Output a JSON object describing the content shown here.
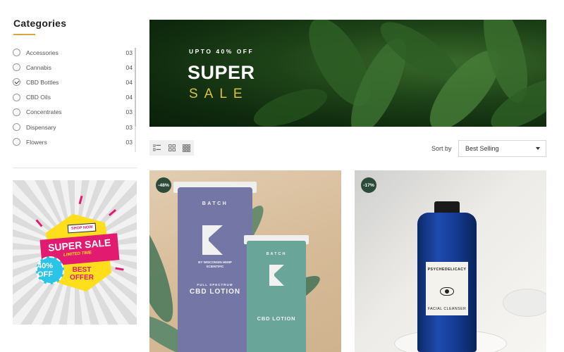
{
  "sidebar": {
    "title": "Categories",
    "categories": [
      {
        "label": "Accessories",
        "count": "03",
        "checked": false
      },
      {
        "label": "Cannabis",
        "count": "04",
        "checked": false
      },
      {
        "label": "CBD Bottles",
        "count": "04",
        "checked": true
      },
      {
        "label": "CBD Oils",
        "count": "04",
        "checked": false
      },
      {
        "label": "Concentrates",
        "count": "03",
        "checked": false
      },
      {
        "label": "Dispensary",
        "count": "03",
        "checked": false
      },
      {
        "label": "Flowers",
        "count": "03",
        "checked": false
      }
    ],
    "promo": {
      "shop_now": "SHOP NOW",
      "super_sale": "SUPER SALE",
      "limited_time": "LIMITED TIME",
      "badge": "40% OFF",
      "best_offer": "BEST OFFER"
    }
  },
  "banner": {
    "upto": "UPTO 40% OFF",
    "headline": "SUPER",
    "subheadline": "SALE"
  },
  "toolbar": {
    "views": [
      "list-view-icon",
      "grid-2-icon",
      "grid-3-icon"
    ],
    "sort_label": "Sort by",
    "sort_value": "Best Selling"
  },
  "products": [
    {
      "discount": "-48%",
      "brand": "BATCH",
      "brand_small": "BATCH",
      "maker": "BY WISCONSIN HEMP SCIENTIFIC",
      "type": "FULL SPECTRUM",
      "name": "CBD LOTION",
      "name_small": "CBD LOTION"
    },
    {
      "discount": "-17%",
      "brand": "PSYCHEDELICACY",
      "name": "FACIAL CLEANSER"
    }
  ],
  "colors": {
    "accent_gold": "#d9a441",
    "banner_gold": "#d9c04a",
    "promo_pink": "#e21b70",
    "promo_yellow": "#ffdf1b",
    "discount_badge": "#2c4a3a"
  }
}
